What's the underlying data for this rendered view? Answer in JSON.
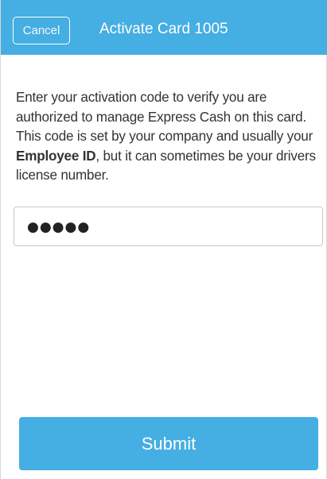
{
  "header": {
    "cancel_label": "Cancel",
    "title": "Activate Card 1005"
  },
  "instructions": {
    "before_bold": "Enter your activation code to verify you are authorized to manage Express Cash on this card. This code is set by your company and usually your ",
    "bold": "Employee ID",
    "after_bold": ", but it can sometimes be your drivers license number."
  },
  "activation_code": {
    "masked_value": "●●●●●"
  },
  "actions": {
    "submit_label": "Submit"
  },
  "colors": {
    "accent": "#45aee2",
    "text": "#333333",
    "background": "#ffffff"
  }
}
